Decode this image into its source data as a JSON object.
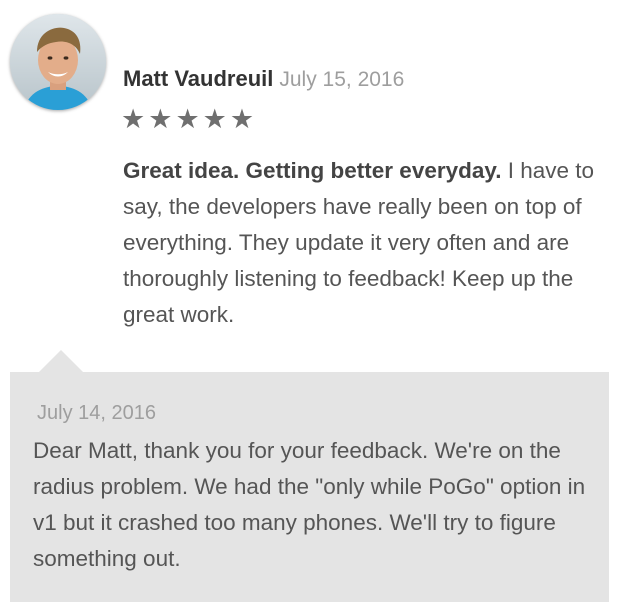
{
  "review": {
    "author": "Matt Vaudreuil",
    "date": "July 15, 2016",
    "rating": 5,
    "stars": [
      "★",
      "★",
      "★",
      "★",
      "★"
    ],
    "title": "Great idea. Getting better everyday.",
    "body": " I have to say, the developers have really been on top of everything. They update it very often and are thoroughly listening to feedback! Keep up the great work."
  },
  "reply": {
    "date": "July 14, 2016",
    "text": "Dear Matt, thank you for your feedback. We're on the radius problem. We had the \"only while PoGo\" option in v1 but it crashed too many phones. We'll try to figure something out."
  },
  "colors": {
    "star": "#6f6f6f",
    "reply_background": "#e4e4e4",
    "date_text": "#9e9e9e"
  }
}
